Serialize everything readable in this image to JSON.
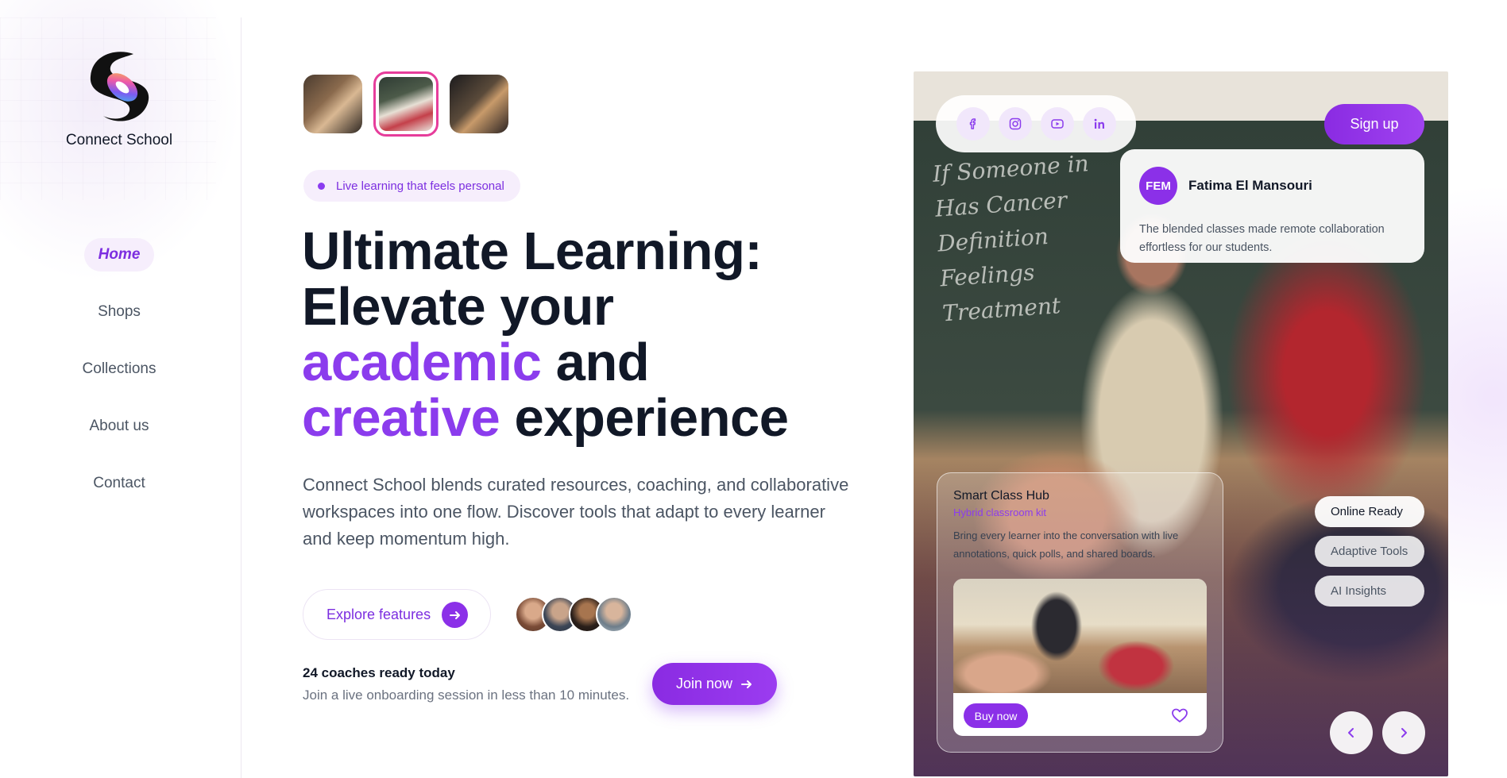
{
  "brand": {
    "name": "Connect School",
    "accent": "#8b3ced",
    "highlight": "#e63d9b"
  },
  "sidebar": {
    "items": [
      {
        "label": "Home",
        "active": true
      },
      {
        "label": "Shops",
        "active": false
      },
      {
        "label": "Collections",
        "active": false
      },
      {
        "label": "About us",
        "active": false
      },
      {
        "label": "Contact",
        "active": false
      }
    ]
  },
  "hero": {
    "thumbnails": [
      "classroom-photo",
      "classroom-photo-selected",
      "bookshelf-photo"
    ],
    "tag": "Live learning that feels personal",
    "headline": {
      "line1": "Ultimate Learning:",
      "line2": "Elevate your",
      "accent1": "academic",
      "mid": "and",
      "accent2": "creative",
      "end": "experience"
    },
    "lead": "Connect School blends curated resources, coaching, and collaborative workspaces into one flow. Discover tools that adapt to every learner and keep momentum high.",
    "explore_label": "Explore features",
    "coaches_title": "24 coaches ready today",
    "coaches_sub": "Join a live onboarding session in less than 10 minutes.",
    "join_label": "Join now"
  },
  "panel": {
    "chalkboard": [
      "If Someone in",
      "Has Cancer",
      "Definition",
      "Feelings",
      "Treatment"
    ],
    "social_icons": [
      "facebook-icon",
      "instagram-icon",
      "youtube-icon",
      "linkedin-icon"
    ],
    "signup_label": "Sign up",
    "review": {
      "initials": "FEM",
      "name": "Fatima El Mansouri",
      "text": "The blended classes made remote collaboration effortless for our students."
    },
    "hub": {
      "title": "Smart Class Hub",
      "subtitle": "Hybrid classroom kit",
      "description": "Bring every learner into the conversation with live annotations, quick polls, and shared boards.",
      "buy_label": "Buy now"
    },
    "chips": [
      "Online Ready",
      "Adaptive Tools",
      "AI Insights"
    ]
  }
}
